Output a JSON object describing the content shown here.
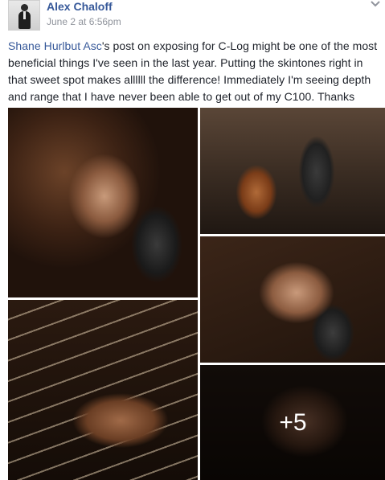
{
  "post": {
    "author_name": "Alex Chaloff",
    "timestamp": "June 2 at 6:56pm",
    "mention": "Shane Hurlbut Asc",
    "body_text": "'s post on exposing for C-Log might be one of the most beneficial things I've seen in the last year. Putting the skintones right in that sweet spot makes allllll the difference! Immediately I'm seeing depth and range that I have never been able to get out of my C100. Thanks Shane!"
  },
  "photos": {
    "more_count_label": "+5"
  },
  "icons": {
    "options": "chevron-down-icon",
    "avatar": "profile-photo"
  },
  "colors": {
    "link": "#365899",
    "text": "#1d2129",
    "meta": "#90949c"
  }
}
